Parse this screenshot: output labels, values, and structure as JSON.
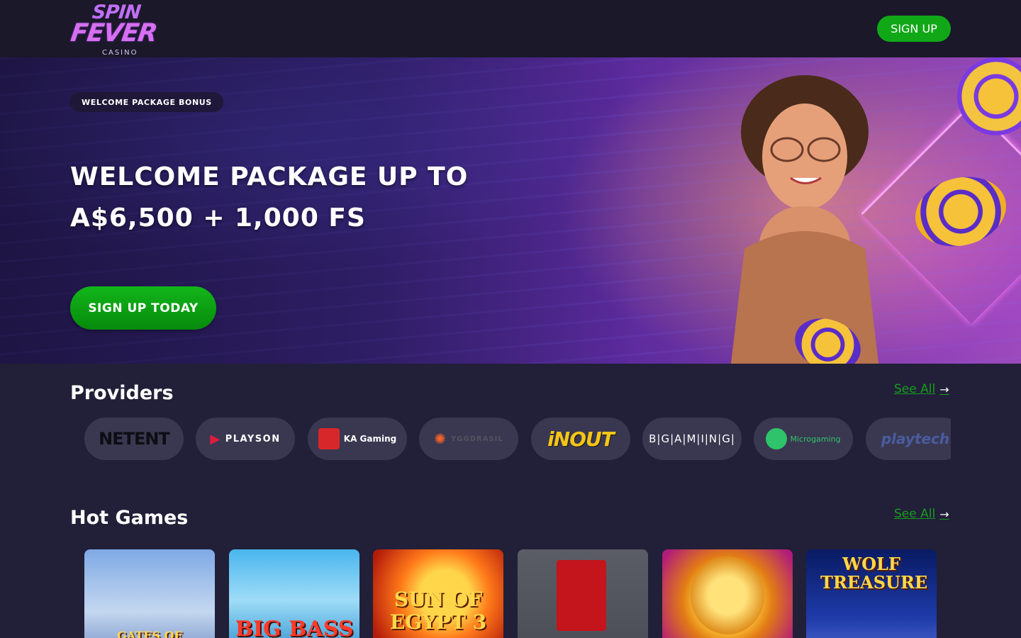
{
  "header": {
    "logo": {
      "line1": "SPIN",
      "line2": "FEVER",
      "line3": "CASINO"
    },
    "signup_label": "SIGN UP"
  },
  "hero": {
    "badge": "WELCOME PACKAGE BONUS",
    "title_line1": "WELCOME PACKAGE UP TO",
    "title_line2": "A$6,500 + 1,000 FS",
    "cta_label": "SIGN UP TODAY"
  },
  "providers": {
    "title": "Providers",
    "see_all": "See All",
    "items": [
      {
        "name": "NETENT"
      },
      {
        "name": "PLAYSON"
      },
      {
        "name": "KA Gaming"
      },
      {
        "name": "YGGDRASIL"
      },
      {
        "name": "iNOUT"
      },
      {
        "name": "B|G|A|M|I|N|G|"
      },
      {
        "name": "Microgaming"
      },
      {
        "name": "playtech"
      }
    ]
  },
  "hot_games": {
    "title": "Hot Games",
    "see_all": "See All",
    "items": [
      {
        "name": "GATES OF OLYMPUS"
      },
      {
        "name": "BIG BASS"
      },
      {
        "name": "SUN OF EGYPT 3"
      },
      {
        "name": ""
      },
      {
        "name": ""
      },
      {
        "name": "WOLF TREASURE"
      }
    ]
  },
  "colors": {
    "accent_green": "#11a818",
    "link_green": "#159e1c",
    "background": "#221f38",
    "header": "#1a1829"
  }
}
